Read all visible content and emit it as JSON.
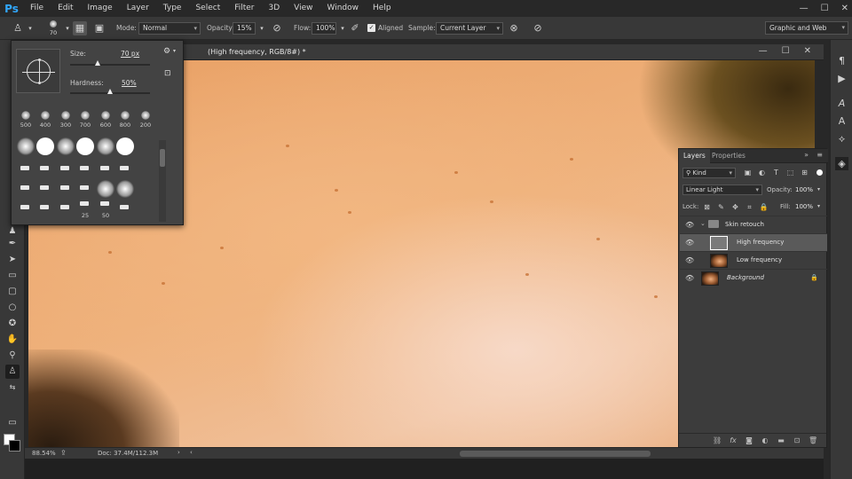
{
  "app": {
    "logo": "Ps"
  },
  "menu": [
    "File",
    "Edit",
    "Image",
    "Layer",
    "Type",
    "Select",
    "Filter",
    "3D",
    "View",
    "Window",
    "Help"
  ],
  "window_controls": {
    "minimize": "—",
    "maximize": "☐",
    "close": "✕"
  },
  "options_bar": {
    "brush_size": "70",
    "mode_label": "Mode:",
    "mode_value": "Normal",
    "opacity_label": "Opacity:",
    "opacity_value": "15%",
    "flow_label": "Flow:",
    "flow_value": "100%",
    "aligned_label": "Aligned",
    "aligned_checked": true,
    "sample_label": "Sample:",
    "sample_value": "Current Layer",
    "workspace": "Graphic and Web"
  },
  "document": {
    "title": "(High frequency, RGB/8#) *",
    "zoom": "88.54%",
    "doc_info": "Doc: 37.4M/112.3M"
  },
  "brush_picker": {
    "size_label": "Size:",
    "size_value": "70 px",
    "hardness_label": "Hardness:",
    "hardness_value": "50%",
    "size_level": 0.35,
    "hardness_level": 0.5,
    "preset_sizes": [
      "500",
      "400",
      "300",
      "700",
      "600",
      "800",
      "200"
    ],
    "row_labels": [
      "25",
      "50"
    ]
  },
  "layers_panel": {
    "tabs": [
      "Layers",
      "Properties"
    ],
    "kind_label": "Kind",
    "blend_mode": "Linear Light",
    "opacity_label": "Opacity:",
    "opacity_value": "100%",
    "lock_label": "Lock:",
    "fill_label": "Fill:",
    "fill_value": "100%",
    "layers": [
      {
        "name": "Skin retouch",
        "type": "group",
        "visible": true
      },
      {
        "name": "High frequency",
        "type": "layer",
        "visible": true,
        "selected": true
      },
      {
        "name": "Low frequency",
        "type": "layer",
        "visible": true
      },
      {
        "name": "Background",
        "type": "layer",
        "visible": true,
        "locked": true
      }
    ]
  },
  "colors": {
    "accent": "#31a8ff",
    "foreground": "#ffffff",
    "background": "#000000"
  },
  "icons": {
    "tools": [
      "clone-stamp-icon",
      "pen-icon",
      "path-select-icon",
      "rectangle-icon",
      "ellipse-icon",
      "custom-shape-icon",
      "hand-icon",
      "zoom-icon",
      "stamp-active-icon"
    ],
    "right_strip": [
      "paragraph-icon",
      "play-icon",
      "character-icon",
      "glyph-icon",
      "paths-icon",
      "layers-icon"
    ]
  }
}
